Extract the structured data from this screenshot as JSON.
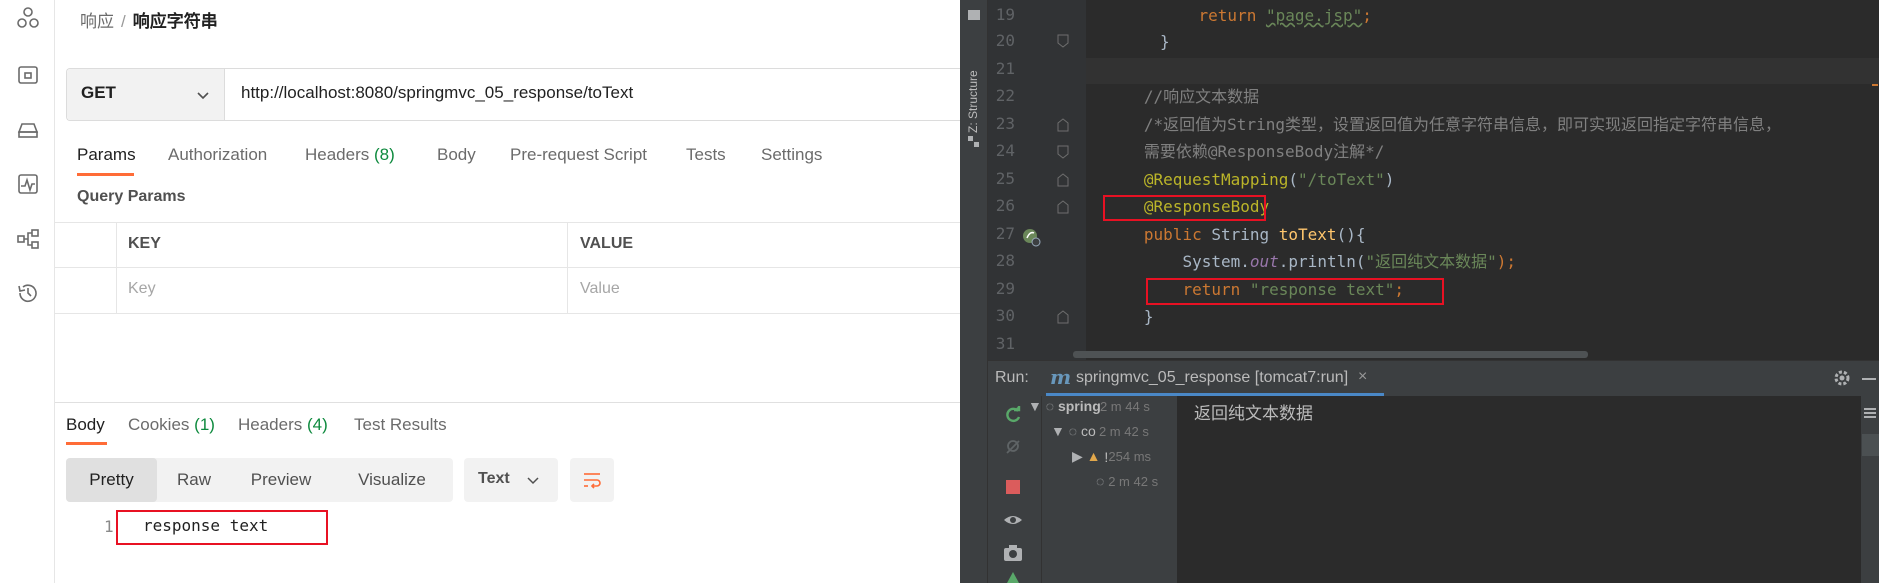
{
  "postman": {
    "breadcrumb": {
      "parent": "响应",
      "separator": "/",
      "current": "响应字符串"
    },
    "request": {
      "method": "GET",
      "url": "http://localhost:8080/springmvc_05_response/toText"
    },
    "request_tabs": [
      {
        "label": "Params",
        "count": "",
        "active": true
      },
      {
        "label": "Authorization",
        "count": ""
      },
      {
        "label": "Headers",
        "count": "(8)"
      },
      {
        "label": "Body",
        "count": ""
      },
      {
        "label": "Pre-request Script",
        "count": ""
      },
      {
        "label": "Tests",
        "count": ""
      },
      {
        "label": "Settings",
        "count": ""
      }
    ],
    "query_params": {
      "title": "Query Params",
      "columns": [
        "KEY",
        "VALUE"
      ],
      "placeholders": [
        "Key",
        "Value"
      ]
    },
    "response_tabs": [
      {
        "label": "Body",
        "count": "",
        "active": true
      },
      {
        "label": "Cookies",
        "count": "(1)"
      },
      {
        "label": "Headers",
        "count": "(4)"
      },
      {
        "label": "Test Results",
        "count": ""
      }
    ],
    "view_modes": [
      "Pretty",
      "Raw",
      "Preview",
      "Visualize"
    ],
    "active_view_mode": "Pretty",
    "format": "Text",
    "response_body": {
      "line_number": "1",
      "text": "response text"
    },
    "accent_color": "#ff6c37",
    "highlight_color": "#e81123"
  },
  "ide": {
    "structure_label": "Z: Structure",
    "lines": [
      {
        "n": "19",
        "code": "return \"page.jsp\";"
      },
      {
        "n": "20",
        "code": "}"
      },
      {
        "n": "21",
        "code": ""
      },
      {
        "n": "22",
        "code": "//响应文本数据"
      },
      {
        "n": "23",
        "code": "/*返回值为String类型，设置返回值为任意字符串信息，即可实现返回指定字符串信息，"
      },
      {
        "n": "24",
        "code": "需要依赖@ResponseBody注解*/"
      },
      {
        "n": "25",
        "code": "@RequestMapping(\"/toText\")"
      },
      {
        "n": "26",
        "code": "@ResponseBody"
      },
      {
        "n": "27",
        "code": "public String toText(){"
      },
      {
        "n": "28",
        "code": "System.out.println(\"返回纯文本数据\");"
      },
      {
        "n": "29",
        "code": "return \"response text\";"
      },
      {
        "n": "30",
        "code": "}"
      },
      {
        "n": "31",
        "code": ""
      }
    ],
    "tokens": {
      "return_kw": "return",
      "page_jsp": "\"page.jsp\"",
      "semicolon": ";",
      "close_brace": "}",
      "comment22": "//响应文本数据",
      "comment23": "/*返回值为String类型，设置返回值为任意字符串信息，即可实现返回指定字符串信息，",
      "comment24": "需要依赖@ResponseBody注解*/",
      "request_mapping": "@RequestMapping",
      "open_paren": "(",
      "to_text_path": "\"/toText\"",
      "close_paren": ")",
      "response_body": "@ResponseBody",
      "public_kw": "public",
      "string_type": " String ",
      "method_name": "toText",
      "method_tail": "(){",
      "system": "System.",
      "out_field": "out",
      "println": ".println(",
      "println_arg": "\"返回纯文本数据\"",
      "println_end": ");",
      "response_text_str": "\"response text\""
    },
    "run": {
      "label": "Run:",
      "tab_label": "springmvc_05_response [tomcat7:run]",
      "tab_icon": "maven-m-icon",
      "close": "×",
      "tree": [
        {
          "label": "spring",
          "time": "2 m 44 s"
        },
        {
          "label": "co",
          "time": "2 m 42 s"
        },
        {
          "label": "!",
          "time": "254 ms"
        },
        {
          "label": "",
          "time": "2 m 42 s"
        }
      ],
      "console_output": "返回纯文本数据"
    },
    "highlight_color": "#e81123"
  }
}
